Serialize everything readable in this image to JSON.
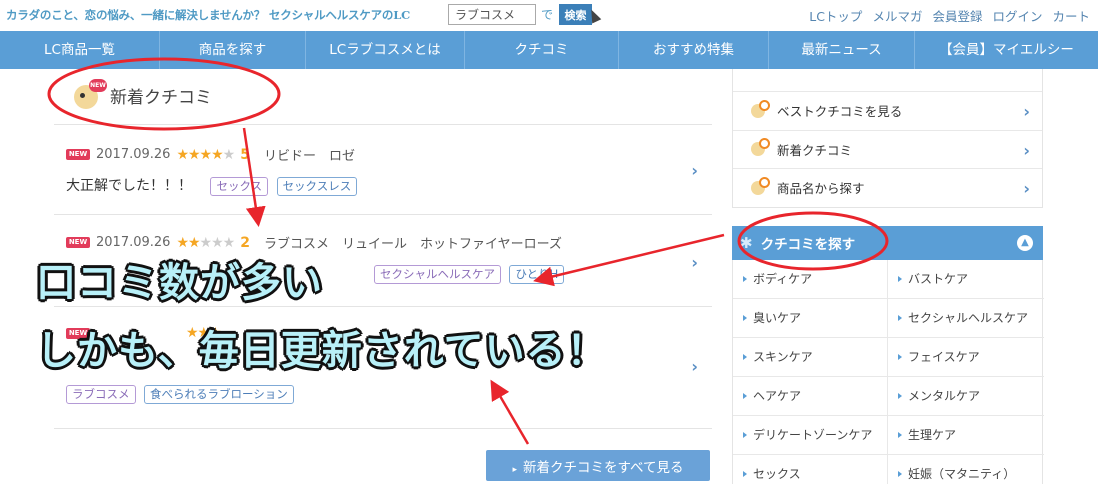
{
  "topbar": {
    "tagline": "カラダのこと、恋の悩み、一緒に解決しませんか？ セクシャルヘルスケアのLC",
    "search_value": "ラブコスメ",
    "search_de": "で",
    "search_button": "検索",
    "links": [
      "LCトップ",
      "メルマガ",
      "会員登録",
      "ログイン",
      "カート"
    ]
  },
  "nav": {
    "items": [
      "LC商品一覧",
      "商品を探す",
      "LCラブコスメとは",
      "クチコミ",
      "おすすめ特集",
      "最新ニュース",
      "【会員】マイエルシー"
    ]
  },
  "main": {
    "section_title": "新着クチコミ",
    "reviews": [
      {
        "badge": "NEW",
        "date": "2017.09.26",
        "stars_filled": 4,
        "stars_on": "★★★★",
        "stars_off": "★",
        "rating": "5",
        "product": "リビドー　ロゼ",
        "text": "大正解でした！！！",
        "tags": [
          "セックス",
          "セックスレス"
        ]
      },
      {
        "badge": "NEW",
        "date": "2017.09.26",
        "stars_filled": 2,
        "stars_on": "★★",
        "stars_off": "★★★",
        "rating": "2",
        "product": "ラブコスメ　リュイール　ホットファイヤーローズ",
        "text": "…",
        "tags": [
          "セクシャルヘルスケア",
          "ひとりH"
        ]
      },
      {
        "badge": "NEW",
        "stars_on": "★★★",
        "tags": [
          "ラブコスメ",
          "食べられるラブローション"
        ]
      }
    ],
    "all_button": "新着クチコミをすべて見る"
  },
  "sidebar": {
    "menu": [
      "ベストクチコミを見る",
      "新着クチコミ",
      "商品名から探す"
    ],
    "search_head": "クチコミを探す",
    "categories": [
      "ボディケア",
      "バストケア",
      "臭いケア",
      "セクシャルヘルスケア",
      "スキンケア",
      "フェイスケア",
      "ヘアケア",
      "メンタルケア",
      "デリケートゾーンケア",
      "生理ケア",
      "セックス",
      "妊娠（マタニティ）"
    ]
  },
  "annotation": {
    "caption_1": "口コミ数が多い",
    "caption_2": "しかも、毎日更新されている！",
    "color": "#e8252c"
  }
}
